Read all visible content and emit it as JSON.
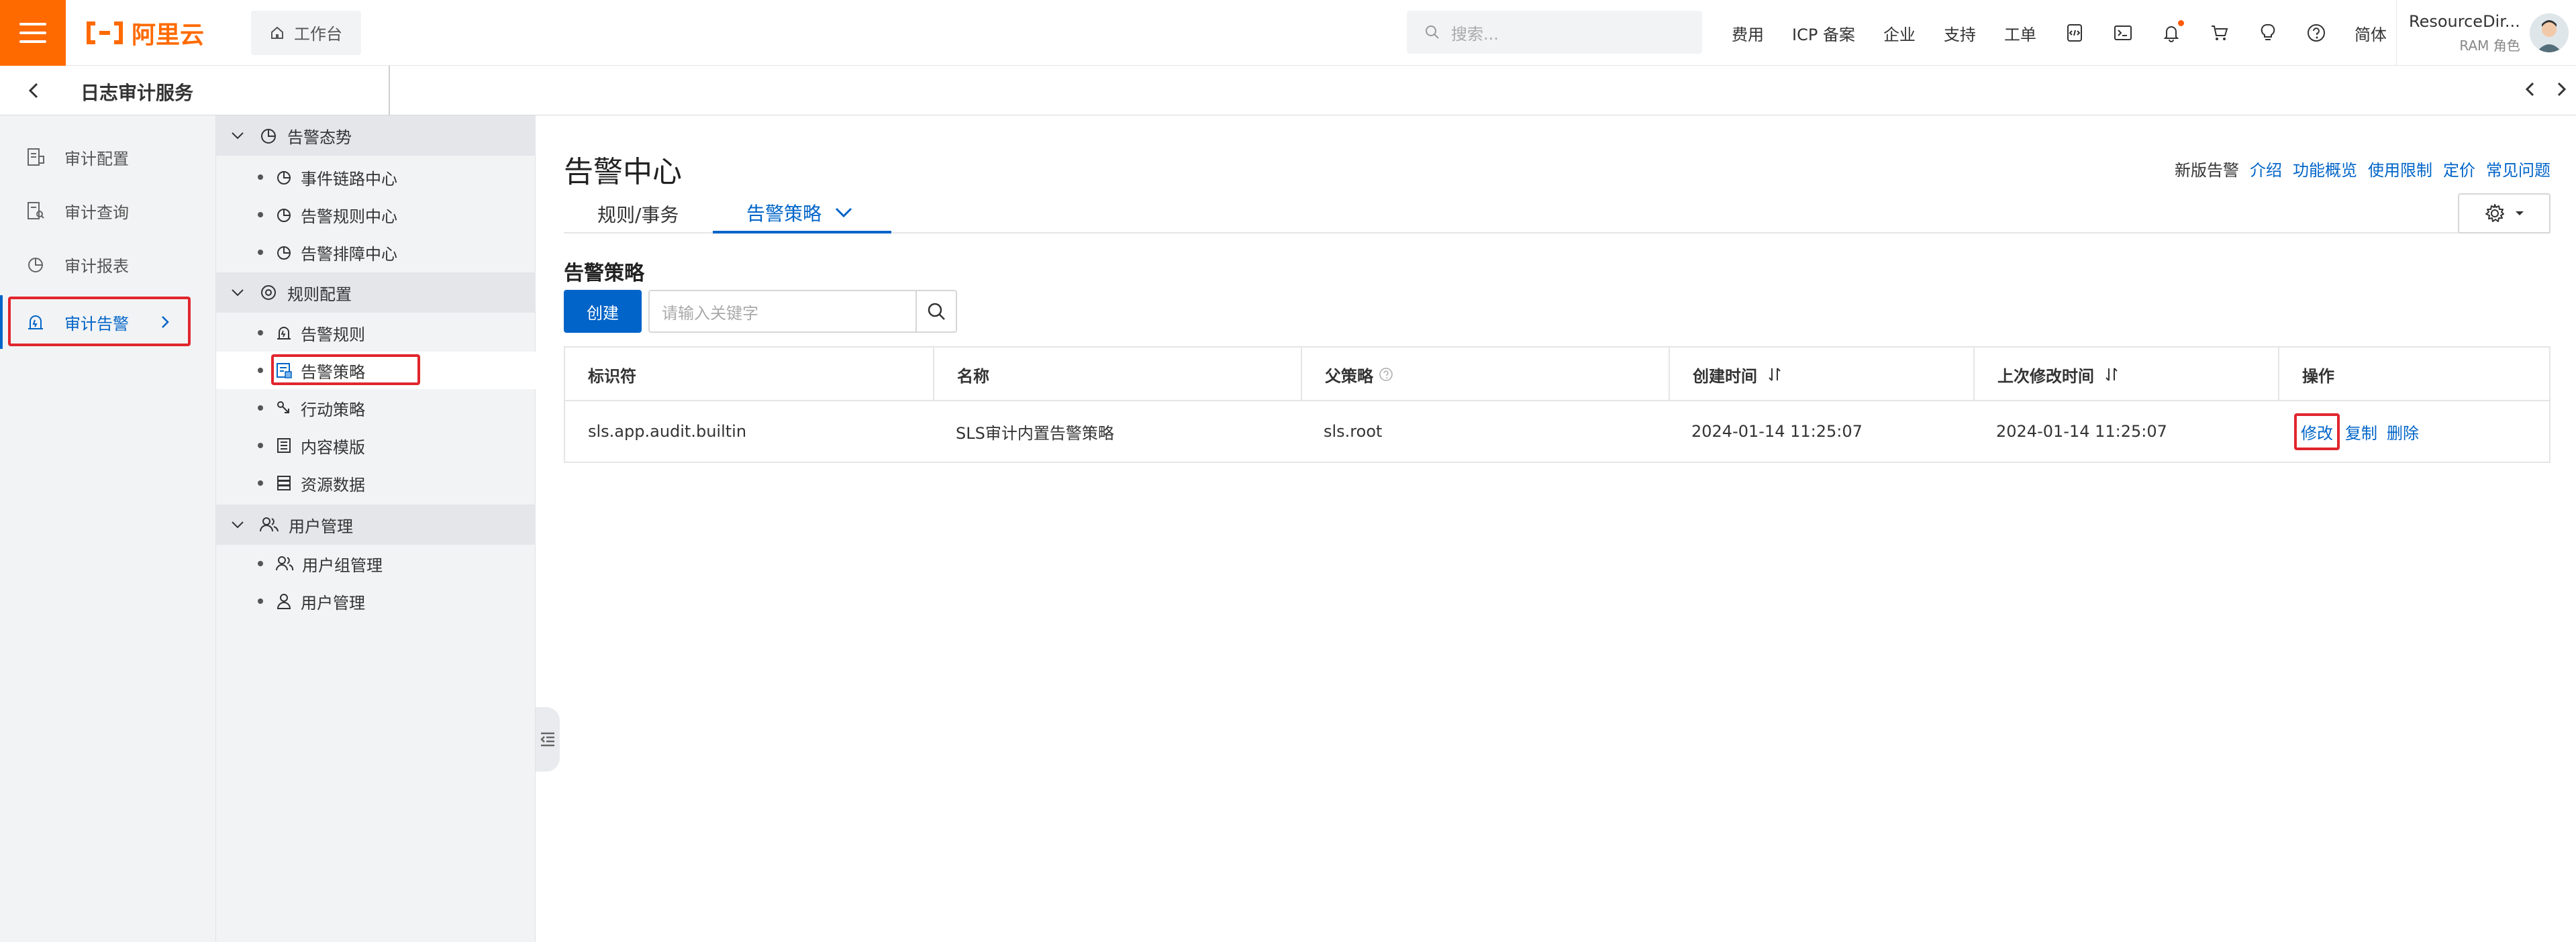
{
  "header": {
    "brand": "阿里云",
    "workbench": "工作台",
    "search_placeholder": "搜索...",
    "nav": [
      "费用",
      "ICP 备案",
      "企业",
      "支持",
      "工单"
    ],
    "lang": "简体",
    "user_name": "ResourceDir...",
    "user_role": "RAM 角色"
  },
  "subbar": {
    "service_title": "日志审计服务"
  },
  "rail": {
    "items": [
      {
        "label": "审计配置",
        "icon": "doc-config-icon"
      },
      {
        "label": "审计查询",
        "icon": "doc-search-icon"
      },
      {
        "label": "审计报表",
        "icon": "pie-chart-icon"
      },
      {
        "label": "审计告警",
        "icon": "alarm-icon",
        "active": true
      }
    ]
  },
  "menu": {
    "groups": [
      {
        "label": "告警态势",
        "items": [
          "事件链路中心",
          "告警规则中心",
          "告警排障中心"
        ]
      },
      {
        "label": "规则配置",
        "items": [
          "告警规则",
          "告警策略",
          "行动策略",
          "内容模版",
          "资源数据"
        ]
      },
      {
        "label": "用户管理",
        "items": [
          "用户组管理",
          "用户管理"
        ]
      }
    ],
    "selected": "告警策略"
  },
  "main": {
    "title": "告警中心",
    "help_plain": "新版告警",
    "help_links": [
      "介绍",
      "功能概览",
      "使用限制",
      "定价",
      "常见问题"
    ],
    "tabs": [
      "规则/事务",
      "告警策略"
    ],
    "section_title": "告警策略",
    "create_label": "创建",
    "keyword_placeholder": "请输入关键字",
    "table": {
      "columns": [
        "标识符",
        "名称",
        "父策略",
        "创建时间",
        "上次修改时间",
        "操作"
      ],
      "rows": [
        {
          "id": "sls.app.audit.builtin",
          "name": "SLS审计内置告警策略",
          "parent": "sls.root",
          "created": "2024-01-14 11:25:07",
          "modified": "2024-01-14 11:25:07",
          "actions": [
            "修改",
            "复制",
            "删除"
          ]
        }
      ]
    }
  },
  "colors": {
    "brand_orange": "#ff6a00",
    "accent_blue": "#0064c8",
    "highlight_red": "#e0262d"
  }
}
